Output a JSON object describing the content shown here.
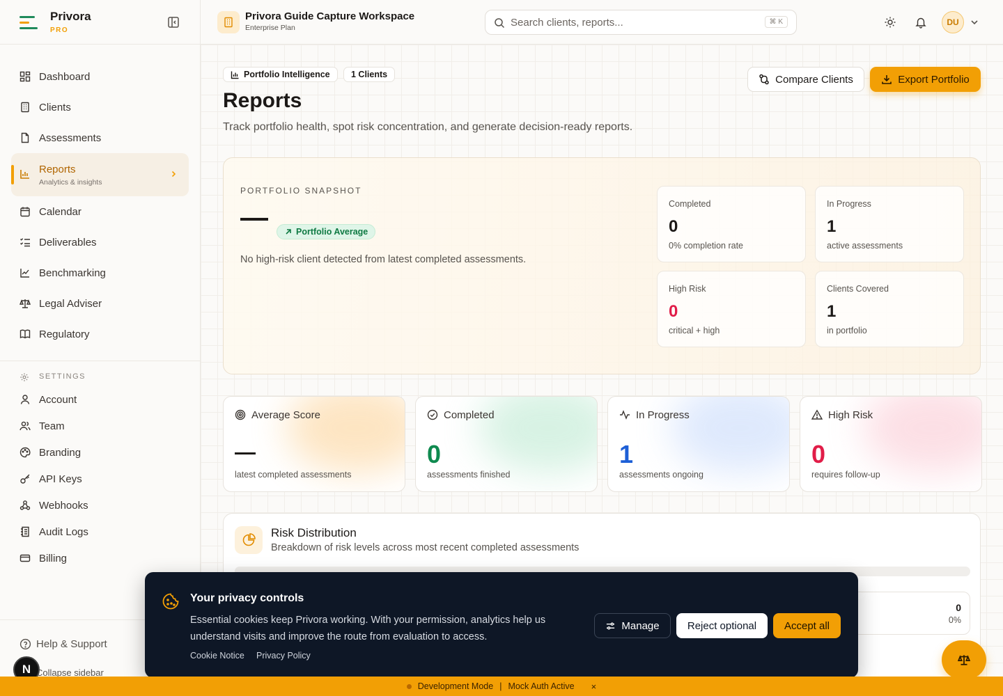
{
  "brand": {
    "name": "Privora",
    "tier": "PRO"
  },
  "sidebar": {
    "items": [
      {
        "label": "Dashboard"
      },
      {
        "label": "Clients"
      },
      {
        "label": "Assessments"
      },
      {
        "label": "Reports",
        "sublabel": "Analytics & insights"
      },
      {
        "label": "Calendar"
      },
      {
        "label": "Deliverables"
      },
      {
        "label": "Benchmarking"
      },
      {
        "label": "Legal Adviser"
      },
      {
        "label": "Regulatory"
      }
    ],
    "settings_heading": "SETTINGS",
    "settings_items": [
      {
        "label": "Account"
      },
      {
        "label": "Team"
      },
      {
        "label": "Branding"
      },
      {
        "label": "API Keys"
      },
      {
        "label": "Webhooks"
      },
      {
        "label": "Audit Logs"
      },
      {
        "label": "Billing"
      }
    ],
    "help_label": "Help & Support",
    "collapse_label": "Collapse sidebar",
    "user_badge": "N"
  },
  "topbar": {
    "workspace_title": "Privora Guide Capture Workspace",
    "workspace_plan": "Enterprise Plan",
    "search_placeholder": "Search clients, reports...",
    "search_shortcut": "⌘ K",
    "avatar_initials": "DU"
  },
  "page": {
    "chip_intel": "Portfolio Intelligence",
    "chip_clients": "1 Clients",
    "title": "Reports",
    "subtitle": "Track portfolio health, spot risk concentration, and generate decision-ready reports.",
    "compare_label": "Compare Clients",
    "export_label": "Export Portfolio"
  },
  "snapshot": {
    "label": "PORTFOLIO SNAPSHOT",
    "badge": "Portfolio Average",
    "note": "No high-risk client detected from latest completed assessments.",
    "cards": [
      {
        "label": "Completed",
        "value": "0",
        "sub": "0% completion rate"
      },
      {
        "label": "In Progress",
        "value": "1",
        "sub": "active assessments"
      },
      {
        "label": "High Risk",
        "value": "0",
        "sub": "critical + high"
      },
      {
        "label": "Clients Covered",
        "value": "1",
        "sub": "in portfolio"
      }
    ]
  },
  "stats": [
    {
      "label": "Average Score",
      "value": "",
      "sub": "latest completed assessments"
    },
    {
      "label": "Completed",
      "value": "0",
      "sub": "assessments finished"
    },
    {
      "label": "In Progress",
      "value": "1",
      "sub": "assessments ongoing"
    },
    {
      "label": "High Risk",
      "value": "0",
      "sub": "requires follow-up"
    }
  ],
  "risk": {
    "title": "Risk Distribution",
    "subtitle": "Breakdown of risk levels across most recent completed assessments",
    "card_value": "0",
    "card_pct": "0%"
  },
  "cookie": {
    "title": "Your privacy controls",
    "body": "Essential cookies keep Privora working. With your permission, analytics help us understand visits and improve the route from evaluation to access.",
    "link_cookie": "Cookie Notice",
    "link_privacy": "Privacy Policy",
    "manage": "Manage",
    "reject": "Reject optional",
    "accept": "Accept all"
  },
  "devbar": {
    "mode": "Development Mode",
    "sep": "|",
    "auth": "Mock Auth Active",
    "close": "×"
  },
  "colors": {
    "accent": "#f29f05",
    "success": "#0f8a4f",
    "info": "#1d5fd6",
    "danger": "#e11d48",
    "dark": "#0e1726"
  }
}
